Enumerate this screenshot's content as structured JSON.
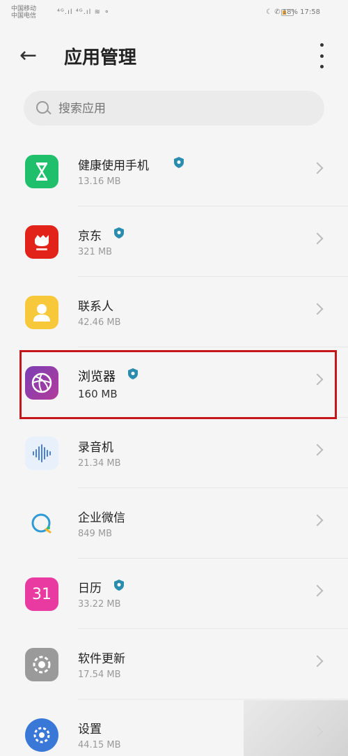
{
  "status_bar": {
    "left_top": "中国移动",
    "left_bottom": "中国电信",
    "signal": "⁴ᴳ.ıl ⁴ᴳ.ıl ≋ ⚬",
    "right": "☾ ✆ 18%   17:58"
  },
  "header": {
    "title": "应用管理"
  },
  "search": {
    "placeholder": "搜索应用"
  },
  "apps": [
    {
      "name": "健康使用手机",
      "size": "13.16 MB",
      "icon": "hourglass-icon",
      "verified": true
    },
    {
      "name": "京东",
      "size": "321 MB",
      "icon": "jd-dog-icon",
      "verified": true
    },
    {
      "name": "联系人",
      "size": "42.46 MB",
      "icon": "contact-person-icon",
      "verified": false
    },
    {
      "name": "浏览器",
      "size": "160 MB",
      "icon": "browser-globe-icon",
      "verified": true
    },
    {
      "name": "录音机",
      "size": "21.34 MB",
      "icon": "waveform-icon",
      "verified": false
    },
    {
      "name": "企业微信",
      "size": "849 MB",
      "icon": "wecom-icon",
      "verified": false
    },
    {
      "name": "日历",
      "size": "33.22 MB",
      "icon": "calendar-icon",
      "verified": true
    },
    {
      "name": "软件更新",
      "size": "17.54 MB",
      "icon": "gear-update-icon",
      "verified": false
    },
    {
      "name": "设置",
      "size": "44.15 MB",
      "icon": "settings-icon",
      "verified": false
    }
  ],
  "calendar_day": "31",
  "colors": {
    "highlight_border": "#c4161c",
    "verified_badge": "#2a8cae"
  }
}
